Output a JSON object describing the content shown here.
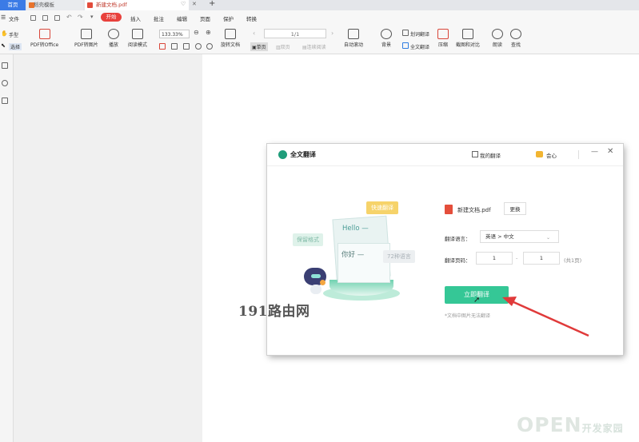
{
  "tabs": {
    "home": "首页",
    "recommend": "稻壳模板",
    "document": "新建文档.pdf"
  },
  "window_controls": {
    "tab_menu": "♡",
    "tab_close": "✕",
    "new_tab": "+"
  },
  "menu": {
    "file": "文件",
    "start": "开始",
    "insert": "插入",
    "annotate": "批注",
    "edit": "编辑",
    "page": "页面",
    "protect": "保护",
    "convert": "转换"
  },
  "toolbar": {
    "hand": "手型",
    "select": "选择",
    "pdf_to_office": "PDF转Office",
    "pdf_to_image": "PDF转图片",
    "play": "播放",
    "read_mode": "阅读模式",
    "zoom": "133.33%",
    "rotate": "旋转文档",
    "page_value": "1/1",
    "single_page": "单页",
    "double_page": "双页",
    "continuous": "连续阅读",
    "auto_scroll": "自动滚动",
    "background": "背景",
    "word_translate": "划词翻译",
    "full_translate": "全文翻译",
    "compress": "压缩",
    "screenshot_compare": "截图和对比",
    "read_aloud": "朗读",
    "search": "查找"
  },
  "dialog": {
    "title": "全文翻译",
    "my_translations": "我的翻译",
    "vip": "会心",
    "minimize": "—",
    "close": "✕",
    "illustration": {
      "fast_translate": "快速翻译",
      "keep_format": "保留格式",
      "languages": "72种语言",
      "hello": "Hello —",
      "nihao": "你好 —"
    },
    "file_name": "新建文档.pdf",
    "change_button": "更换",
    "language_label": "翻译语言：",
    "language_value": "英语 > 中文",
    "page_label": "翻译页码：",
    "page_from": "1",
    "page_dash": "-",
    "page_to": "1",
    "page_total": "(共1页)",
    "translate_button": "立即翻译",
    "note": "*文档中图片无法翻译"
  },
  "watermarks": {
    "site1": "191路由网",
    "site2_main": "OPEN",
    "site2_sub": "开发家园"
  },
  "colors": {
    "accent_tab": "#3b7be6",
    "start_pill": "#e8413c",
    "translate_button": "#35c796",
    "arrow": "#e03a3a"
  }
}
